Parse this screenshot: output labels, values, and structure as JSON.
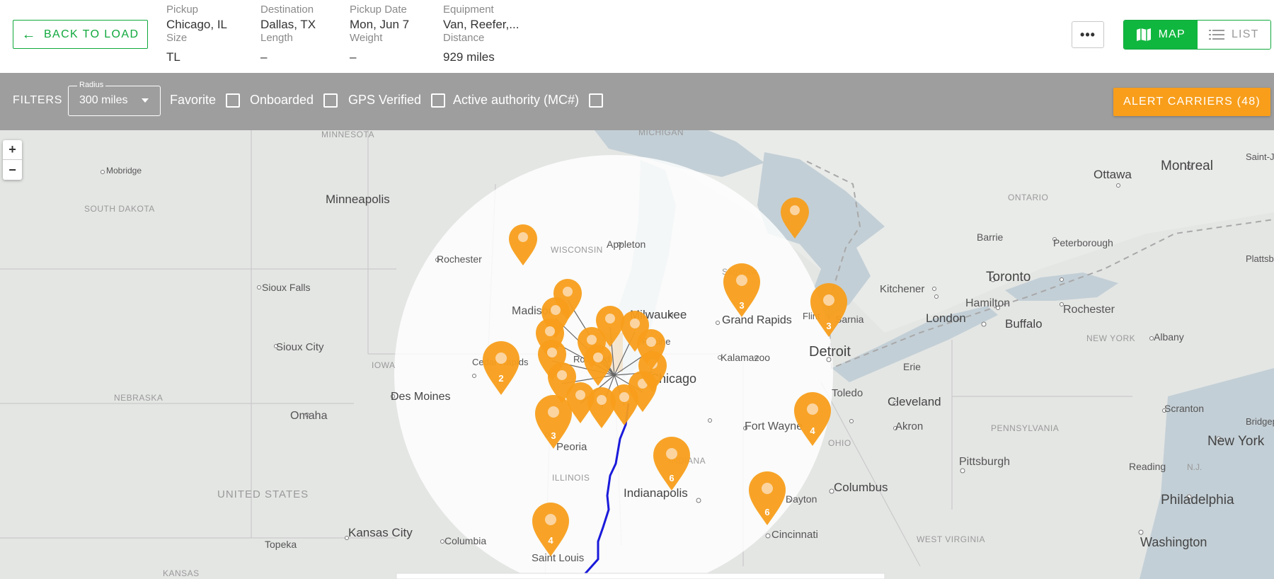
{
  "header": {
    "back_label": "BACK TO LOAD",
    "pickup_label": "Pickup",
    "pickup_value": "Chicago, IL",
    "size_label": "Size",
    "size_value": "TL",
    "destination_label": "Destination",
    "destination_value": "Dallas, TX",
    "length_label": "Length",
    "length_value": "–",
    "pickup_date_label": "Pickup Date",
    "pickup_date_value": "Mon, Jun 7",
    "weight_label": "Weight",
    "weight_value": "–",
    "equipment_label": "Equipment",
    "equipment_value": "Van, Reefer,...",
    "distance_label": "Distance",
    "distance_value": "929 miles",
    "more_label": "•••",
    "map_label": "MAP",
    "list_label": "LIST",
    "active_view": "map",
    "accent_color": "#10b73f"
  },
  "filters": {
    "label": "FILTERS",
    "radius_label": "Radius",
    "radius_value": "300 miles",
    "checkboxes": [
      {
        "label": "Favorite",
        "checked": false
      },
      {
        "label": "Onboarded",
        "checked": false
      },
      {
        "label": "GPS Verified",
        "checked": false
      },
      {
        "label": "Active authority (MC#)",
        "checked": false
      }
    ],
    "alert_label": "ALERT CARRIERS (48)",
    "alert_color": "#f89e1b"
  },
  "map": {
    "zoom_in": "+",
    "zoom_out": "−",
    "marker_color": "#f89e1b",
    "route_color": "#1a1adb",
    "cluster_counts": [
      "3",
      "3",
      "2",
      "3",
      "4",
      "6",
      "6",
      "4"
    ],
    "place_labels": [
      "Minneapolis",
      "Rochester",
      "WISCONSIN",
      "Appleton",
      "Madison",
      "Milwaukee",
      "Racine",
      "Rockford",
      "Chicago",
      "Cedar Rapids",
      "Des Moines",
      "Peoria",
      "ILLINOIS",
      "Indianapolis",
      "INDIANA",
      "Saint Louis",
      "Columbia",
      "Kansas City",
      "Topeka",
      "Omaha",
      "Sioux City",
      "Sioux Falls",
      "SOUTH DAKOTA",
      "Mobridge",
      "NEBRASKA",
      "IOWA",
      "KANSAS",
      "UNITED STATES",
      "MINNESOTA",
      "MICHIGAN",
      "Grand Rapids",
      "Kalamazoo",
      "Detroit",
      "Toledo",
      "Fort Wayne",
      "Dayton",
      "Cincinnati",
      "Columbus",
      "OHIO",
      "Cleveland",
      "Akron",
      "Pittsburgh",
      "PENNSYLVANIA",
      "Philadelphia",
      "New York",
      "Washington",
      "WEST VIRGINIA",
      "Scranton",
      "Reading",
      "N.J.",
      "Toronto",
      "Hamilton",
      "Kitchener",
      "London",
      "Sarnia",
      "Erie",
      "Buffalo",
      "Rochester",
      "NEW YORK",
      "Albany",
      "Barrie",
      "Peterborough",
      "Ottawa",
      "Montreal",
      "ONTARIO",
      "Saint-Jean-sur-Richelieu",
      "Plattsburgh",
      "Bridgeport",
      "Flint",
      "Saginaw"
    ]
  }
}
